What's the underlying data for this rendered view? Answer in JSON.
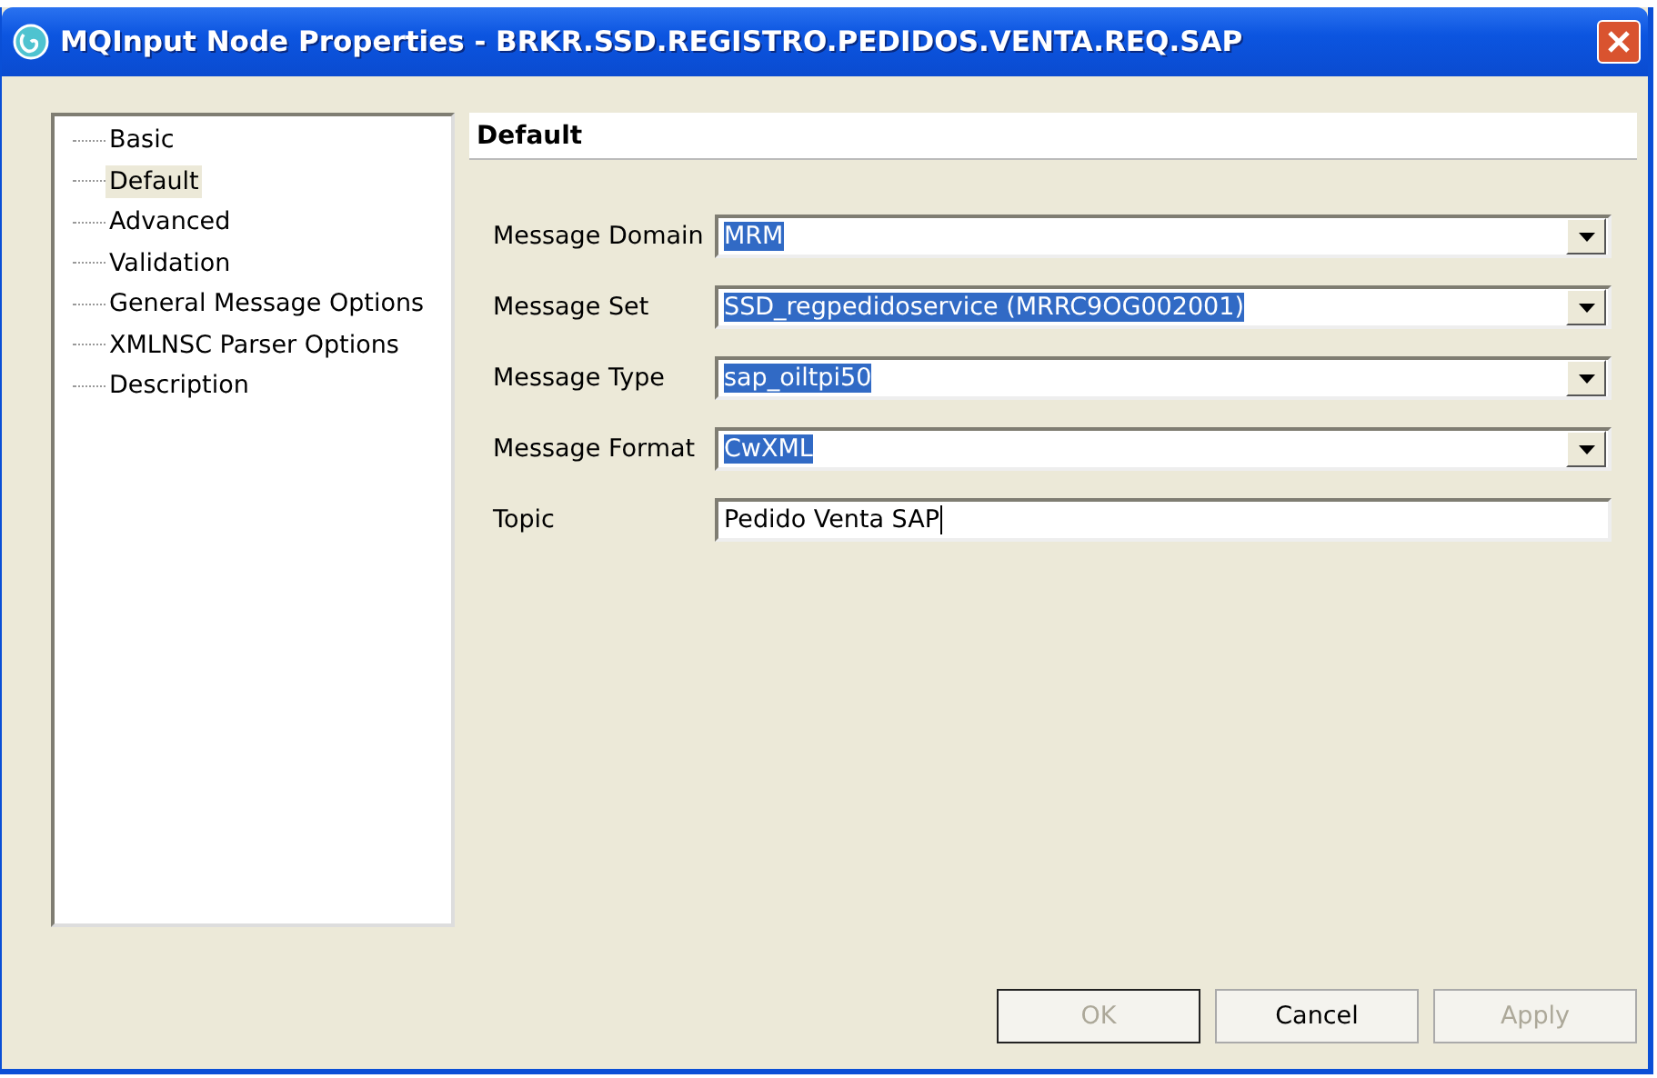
{
  "window": {
    "title": "MQInput Node Properties - BRKR.SSD.REGISTRO.PEDIDOS.VENTA.REQ.SAP"
  },
  "sidebar": {
    "items": [
      {
        "label": "Basic",
        "selected": false
      },
      {
        "label": "Default",
        "selected": true
      },
      {
        "label": "Advanced",
        "selected": false
      },
      {
        "label": "Validation",
        "selected": false
      },
      {
        "label": "General Message Options",
        "selected": false
      },
      {
        "label": "XMLNSC Parser Options",
        "selected": false
      },
      {
        "label": "Description",
        "selected": false
      }
    ]
  },
  "panel": {
    "title": "Default",
    "fields": [
      {
        "kind": "combo",
        "label": "Message Domain",
        "value": "MRM",
        "highlighted": true
      },
      {
        "kind": "combo",
        "label": "Message Set",
        "value": "SSD_regpedidoservice (MRRC9OG002001)",
        "highlighted": true
      },
      {
        "kind": "combo",
        "label": "Message Type",
        "value": "sap_oiltpi50",
        "highlighted": true
      },
      {
        "kind": "combo",
        "label": "Message Format",
        "value": "CwXML",
        "highlighted": true
      },
      {
        "kind": "text",
        "label": "Topic",
        "value": "Pedido Venta SAP",
        "highlighted": false
      }
    ]
  },
  "buttons": [
    {
      "label": "OK",
      "disabled": true,
      "default": true
    },
    {
      "label": "Cancel",
      "disabled": false,
      "default": false
    },
    {
      "label": "Apply",
      "disabled": true,
      "default": false
    }
  ]
}
